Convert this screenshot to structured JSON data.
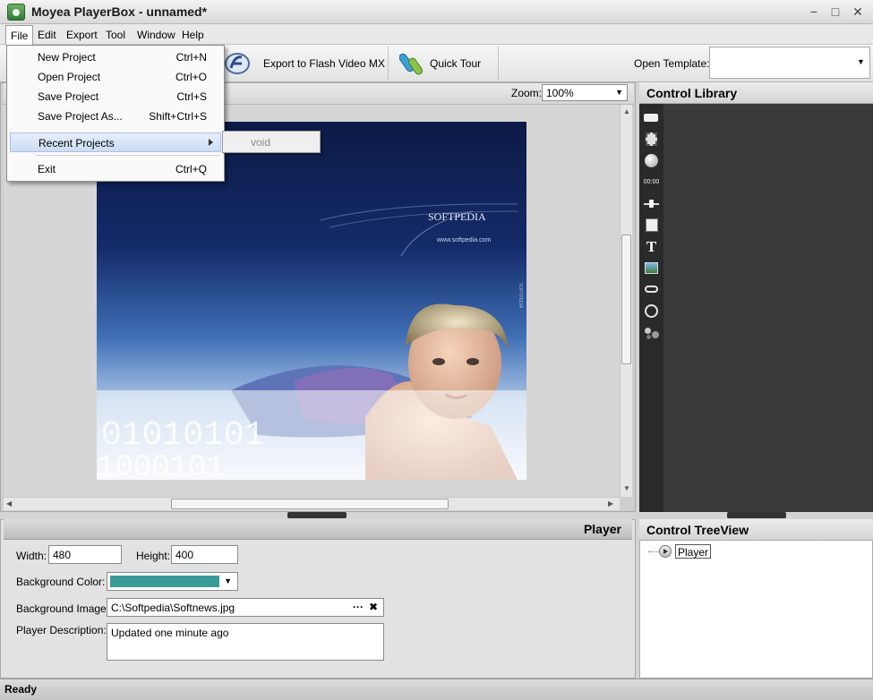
{
  "window": {
    "title": "Moyea PlayerBox - unnamed*",
    "minimize_glyph": "−",
    "maximize_glyph": "□",
    "close_glyph": "✕"
  },
  "menubar": {
    "items": [
      {
        "label": "File",
        "accel": "F"
      },
      {
        "label": "Edit",
        "accel": "E"
      },
      {
        "label": "Export",
        "accel": "x"
      },
      {
        "label": "Tool",
        "accel": "T"
      },
      {
        "label": "Window",
        "accel": "W"
      },
      {
        "label": "Help",
        "accel": "H"
      }
    ]
  },
  "file_menu": {
    "items": [
      {
        "label": "New Project",
        "shortcut": "Ctrl+N"
      },
      {
        "label": "Open Project",
        "shortcut": "Ctrl+O"
      },
      {
        "label": "Save Project",
        "shortcut": "Ctrl+S"
      },
      {
        "label": "Save Project As...",
        "shortcut": "Shift+Ctrl+S"
      },
      {
        "label": "Recent Projects",
        "shortcut": ""
      },
      {
        "label": "Exit",
        "shortcut": "Ctrl+Q"
      }
    ],
    "submenu_item": "void"
  },
  "toolbar": {
    "export_flash_label": "Export to Flash Video MX",
    "quick_tour_label": "Quick Tour",
    "open_template_label": "Open Template:",
    "open_template_value": ""
  },
  "canvas": {
    "zoom_label": "Zoom:",
    "zoom_value": "100%",
    "image_watermark": "SOFTPEDIA",
    "image_watermark_url": "www.softpedia.com",
    "image_side_text": "SOFTPEDIA"
  },
  "control_library": {
    "title": "Control Library",
    "tools": [
      "panel-icon",
      "film-icon",
      "ball-icon",
      "timer-icon",
      "slider-icon",
      "list-icon",
      "text-icon",
      "image-icon",
      "link-icon",
      "counter-icon",
      "particles-icon"
    ],
    "text_tool_glyph": "T",
    "timer_glyph": "00:00"
  },
  "player_props": {
    "title": "Player",
    "width_label": "Width:",
    "width_value": "480",
    "height_label": "Height:",
    "height_value": "400",
    "bg_color_label": "Background Color:",
    "bg_color_value": "#3a9a98",
    "bg_image_label": "Background Image:",
    "bg_image_value": "C:\\Softpedia\\Softnews.jpg",
    "browse_glyph": "···",
    "clear_glyph": "✖",
    "description_label": "Player Description:",
    "description_value": "Updated one minute ago"
  },
  "treeview": {
    "title": "Control TreeView",
    "nodes": [
      {
        "label": "Player"
      }
    ]
  },
  "status": {
    "text": "Ready"
  },
  "colors": {
    "dark_panel": "#3a3a3a",
    "menu_highlight": "#ccdcf5",
    "accent_teal": "#3a9a98"
  }
}
